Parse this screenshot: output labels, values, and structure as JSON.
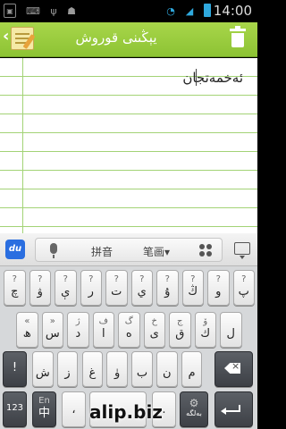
{
  "status": {
    "time": "14:00",
    "icons": [
      "notification-icon",
      "keyboard-icon",
      "usb-icon",
      "android-debug-icon",
      "wifi-icon",
      "signal-icon",
      "battery-icon"
    ]
  },
  "app": {
    "title": "يېڭىنى قوروش"
  },
  "note": {
    "text": "ئەخمەتجان"
  },
  "candidate_bar": {
    "pinyin_label": "拼音",
    "stroke_label": "笔画▾"
  },
  "keys": {
    "row1": [
      {
        "top": "?",
        "main": "چ"
      },
      {
        "top": "?",
        "main": "ۋ"
      },
      {
        "top": "?",
        "main": "ې"
      },
      {
        "top": "?",
        "main": "ر"
      },
      {
        "top": "?",
        "main": "ت"
      },
      {
        "top": "?",
        "main": "ي"
      },
      {
        "top": "?",
        "main": "ۇ"
      },
      {
        "top": "?",
        "main": "ڭ"
      },
      {
        "top": "?",
        "main": "و"
      },
      {
        "top": "?",
        "main": "پ"
      }
    ],
    "row2": [
      {
        "top": "«",
        "main": "ھ"
      },
      {
        "top": "»",
        "main": "س"
      },
      {
        "top": "ژ",
        "main": "د"
      },
      {
        "top": "ف",
        "main": "ا"
      },
      {
        "top": "گ",
        "main": "ە"
      },
      {
        "top": "خ",
        "main": "ى"
      },
      {
        "top": "ج",
        "main": "ق"
      },
      {
        "top": "ۆ",
        "main": "ك"
      },
      {
        "top": "",
        "main": "ل"
      }
    ],
    "row3": [
      {
        "top": "",
        "main": "!"
      },
      {
        "top": "",
        "main": "ش"
      },
      {
        "top": "",
        "main": "ز"
      },
      {
        "top": "",
        "main": "غ"
      },
      {
        "top": "",
        "main": "ۈ"
      },
      {
        "top": "",
        "main": "ب"
      },
      {
        "top": "",
        "main": "ن"
      },
      {
        "top": "",
        "main": "م"
      }
    ],
    "row4": {
      "num": "123",
      "lang_top": "En",
      "lang_main": "中",
      "comma": "،",
      "period": ".",
      "settings": "بەلگە"
    }
  },
  "watermark": "alip.biz",
  "colors": {
    "appbar_green": "#8dc334",
    "ruled_line": "#a3d376",
    "keyboard_bg": "#d6d8da",
    "dark_key": "#45494f"
  }
}
